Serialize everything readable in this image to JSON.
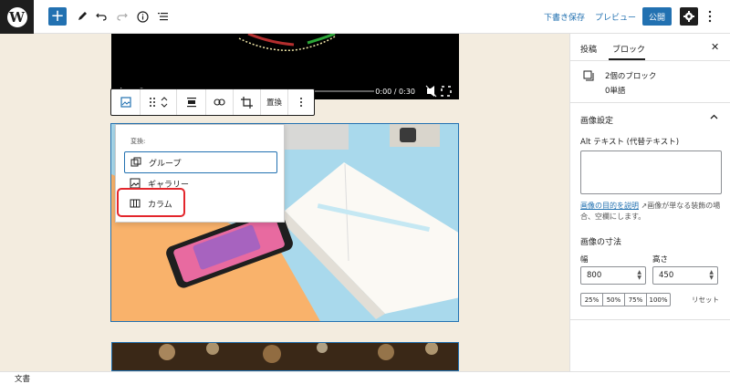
{
  "toolbar": {
    "add_label": "+",
    "save_draft": "下書き保存",
    "preview": "プレビュー",
    "publish": "公開"
  },
  "video": {
    "time": "0:00 / 0:30"
  },
  "block_toolbar": {
    "replace": "置換"
  },
  "transform_menu": {
    "title": "変換:",
    "items": [
      {
        "label": "グループ",
        "icon": "group-icon"
      },
      {
        "label": "ギャラリー",
        "icon": "gallery-icon"
      },
      {
        "label": "カラム",
        "icon": "columns-icon"
      }
    ]
  },
  "sidebar": {
    "tabs": [
      "投稿",
      "ブロック"
    ],
    "block_info": {
      "title": "2個のブロック",
      "subtitle": "0単語"
    },
    "settings_title": "画像設定",
    "alt_label": "Alt テキスト (代替テキスト)",
    "alt_value": "",
    "help_link": "画像の目的を説明",
    "help_text": "画像が単なる装飾の場合、空欄にします。",
    "size_title": "画像の寸法",
    "width_label": "幅",
    "height_label": "高さ",
    "width_value": "800",
    "height_value": "450",
    "percents": [
      "25%",
      "50%",
      "75%",
      "100%"
    ],
    "reset": "リセット"
  },
  "footer": {
    "breadcrumb": "文書"
  },
  "colors": {
    "accent": "#2271b1",
    "highlight": "#e3262c",
    "canvas_bg": "#f3ecdf"
  }
}
